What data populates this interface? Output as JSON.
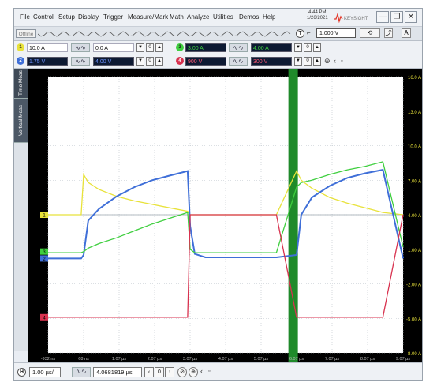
{
  "menu": [
    "File",
    "Control",
    "Setup",
    "Display",
    "Trigger",
    "Measure/Mark",
    "Math",
    "Analyze",
    "Utilities",
    "Demos",
    "Help"
  ],
  "clock": {
    "time": "4:44 PM",
    "date": "1/26/2021"
  },
  "brand": "KEYSIGHT",
  "window_buttons": {
    "minimize": "—",
    "restore": "❐",
    "close": "✕"
  },
  "runbar": {
    "status": "Offline",
    "trigger_level": "1.000 V",
    "trigger_icon": "T"
  },
  "channels": {
    "ch1": {
      "num": "1",
      "scale": "10.0 A",
      "offset": "0.0 A",
      "color": "#e8e23a"
    },
    "ch2": {
      "num": "2",
      "scale": "1.75 V",
      "offset": "4.00 V",
      "color": "#3f6fd8"
    },
    "ch3": {
      "num": "3",
      "scale": "3.00 A",
      "offset": "4.00 A",
      "color": "#3fcf3f"
    },
    "ch4": {
      "num": "4",
      "scale": "900 V",
      "offset": "300 V",
      "color": "#d8324f"
    }
  },
  "side_tabs": [
    "Time Meas",
    "Vertical Meas"
  ],
  "y_ticks": [
    "16.0 A",
    "13.0 A",
    "10.0 A",
    "7.00 A",
    "4.00 A",
    "1.00 A",
    "-2.00 A",
    "-5.00 A",
    "-8.00 A"
  ],
  "x_ticks": [
    "-932 ns",
    "68 ns",
    "1.07 µs",
    "2.07 µs",
    "3.07 µs",
    "4.07 µs",
    "5.07 µs",
    "6.07 µs",
    "7.07 µs",
    "8.07 µs",
    "9.07 µs"
  ],
  "markers": {
    "m1": "1",
    "m2": "2",
    "m3": "3",
    "m4": "4"
  },
  "bottom": {
    "timebase": "1.00 µs/",
    "delay": "4.0681819 µs"
  },
  "chart_data": {
    "type": "line",
    "x": [
      -0.932,
      -0.5,
      0,
      0.068,
      0.2,
      0.5,
      1.0,
      1.5,
      2.0,
      2.5,
      3.0,
      3.07,
      3.2,
      3.5,
      4.07,
      4.5,
      5.0,
      5.5,
      6.07,
      6.2,
      6.5,
      7.0,
      7.5,
      8.0,
      8.5,
      9.07
    ],
    "series": [
      {
        "name": "1",
        "values": [
          4.0,
          4.0,
          4.0,
          7.5,
          6.8,
          6.2,
          5.6,
          5.2,
          4.9,
          4.6,
          4.3,
          4.0,
          4.0,
          4.0,
          4.0,
          4.0,
          4.0,
          4.0,
          7.8,
          7.0,
          6.3,
          5.5,
          5.0,
          4.6,
          4.2,
          4.0
        ]
      },
      {
        "name": "2",
        "values": [
          0.2,
          0.2,
          0.2,
          0.5,
          3.5,
          4.5,
          5.6,
          6.4,
          7.0,
          7.4,
          7.8,
          3.0,
          0.6,
          0.3,
          0.3,
          0.3,
          0.3,
          0.3,
          0.5,
          4.0,
          5.5,
          6.5,
          7.2,
          7.6,
          7.9,
          0.2
        ]
      },
      {
        "name": "3",
        "values": [
          0.7,
          0.7,
          0.7,
          0.8,
          1.1,
          1.5,
          2.0,
          2.6,
          3.2,
          3.7,
          4.2,
          1.0,
          0.7,
          0.7,
          0.7,
          0.7,
          0.7,
          0.7,
          6.4,
          6.8,
          7.0,
          7.5,
          7.9,
          8.2,
          8.6,
          1.2
        ]
      },
      {
        "name": "4",
        "values": [
          -4.9,
          -4.9,
          -4.9,
          -4.9,
          -4.9,
          -4.9,
          -4.9,
          -4.9,
          -4.9,
          -4.9,
          -4.9,
          4.0,
          4.0,
          4.0,
          4.0,
          4.0,
          4.0,
          4.0,
          -4.9,
          -4.9,
          -4.9,
          -4.9,
          -4.9,
          -4.9,
          -4.9,
          4.0
        ]
      }
    ],
    "xlabel": "",
    "ylabel": "",
    "ylim": [
      -8,
      16
    ],
    "xlim": [
      -0.932,
      9.07
    ],
    "grid": true
  }
}
